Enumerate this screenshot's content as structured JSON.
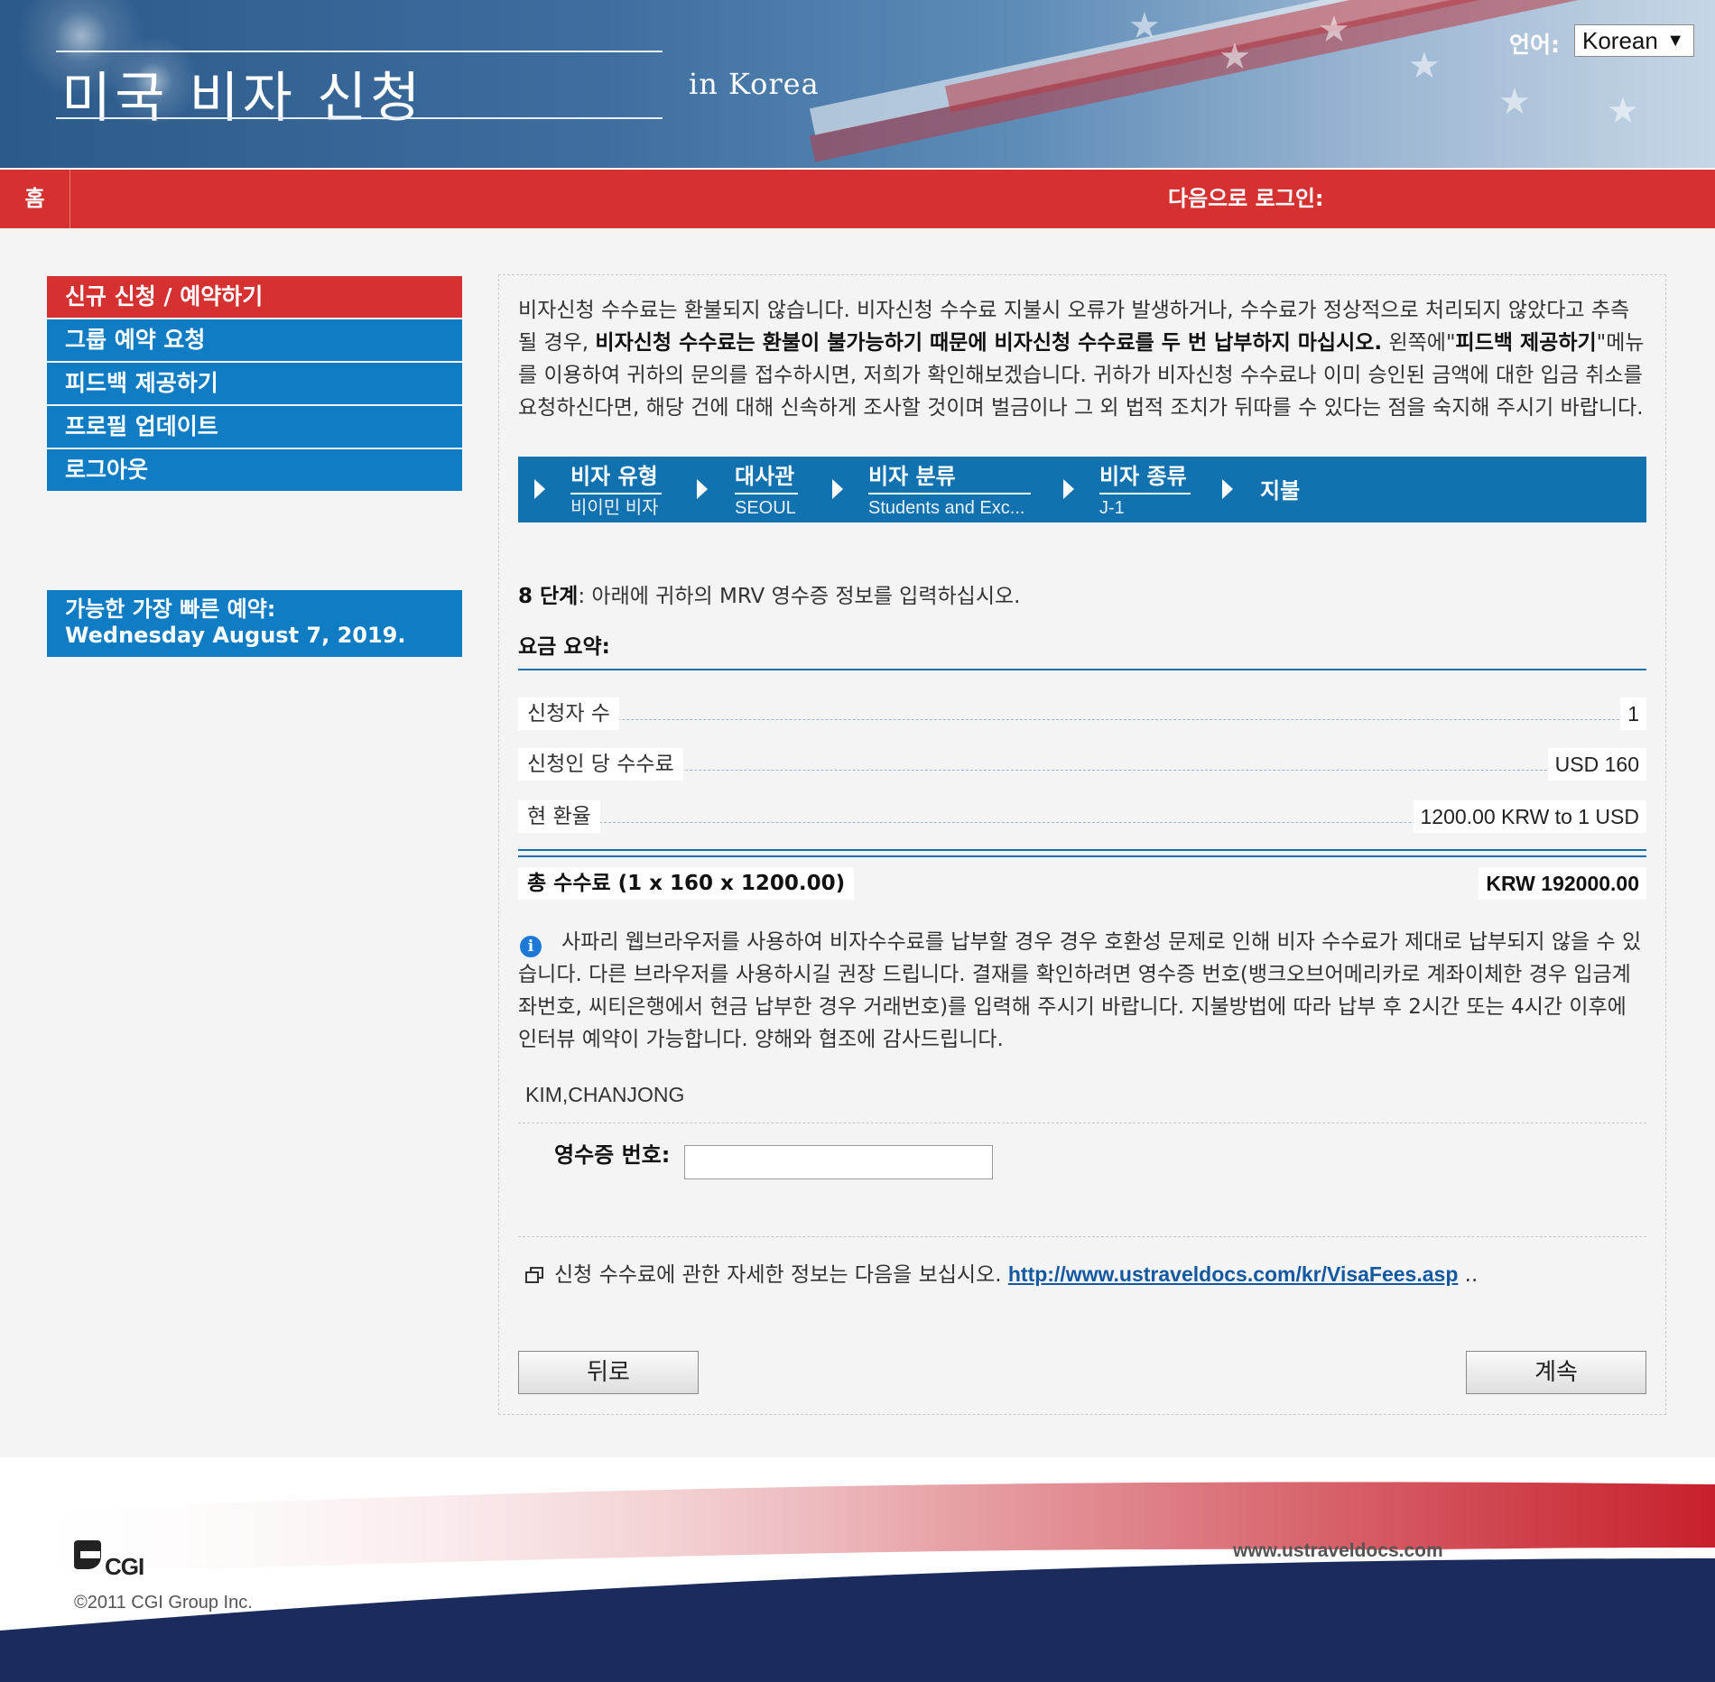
{
  "header": {
    "title": "미국 비자 신청",
    "subtitle": "in  Korea",
    "language_label": "언어:",
    "language_value": "Korean"
  },
  "nav": {
    "home": "홈",
    "logged_in_as": "다음으로 로그인:"
  },
  "sidebar": {
    "items": [
      {
        "label": "신규 신청 / 예약하기",
        "active": true
      },
      {
        "label": "그룹 예약 요청",
        "active": false
      },
      {
        "label": "피드백 제공하기",
        "active": false
      },
      {
        "label": "프로필 업데이트",
        "active": false
      },
      {
        "label": "로그아웃",
        "active": false
      }
    ],
    "earliest_label": "가능한 가장 빠른 예약:",
    "earliest_date": "Wednesday August 7, 2019."
  },
  "intro": {
    "part1": "비자신청 수수료는 환불되지 않습니다. 비자신청 수수료 지불시 오류가 발생하거나, 수수료가 정상적으로 처리되지 않았다고 추측될 경우, ",
    "bold1": "비자신청 수수료는 환불이 불가능하기 때문에 비자신청 수수료를 두 번 납부하지 마십시오.",
    "part2": " 왼쪽에\"",
    "bold2": "피드백 제공하기",
    "part3": "\"메뉴를 이용하여 귀하의 문의를 접수하시면, 저희가 확인해보겠습니다. 귀하가 비자신청 수수료나 이미 승인된 금액에 대한 입금 취소를 요청하신다면, 해당 건에 대해 신속하게 조사할 것이며 벌금이나 그 외 법적 조치가 뒤따를 수 있다는 점을 숙지해 주시기 바랍니다."
  },
  "wizard": {
    "steps": [
      {
        "title": "비자 유형",
        "value": "비이민 비자"
      },
      {
        "title": "대사관",
        "value": "SEOUL"
      },
      {
        "title": "비자 분류",
        "value": "Students and Exc..."
      },
      {
        "title": "비자 종류",
        "value": "J-1"
      }
    ],
    "final": "지불"
  },
  "step": {
    "label": "8 단계",
    "text": ": 아래에 귀하의 MRV 영수증 정보를 입력하십시오."
  },
  "summary": {
    "title": "요금 요약:",
    "rows": [
      {
        "label": "신청자 수",
        "value": "1"
      },
      {
        "label": "신청인 당 수수료",
        "value": "USD 160"
      },
      {
        "label": "현 환율",
        "value": "1200.00 KRW to 1 USD"
      }
    ],
    "total_label": "총 수수료 (1 x 160 x 1200.00)",
    "total_value": "KRW 192000.00"
  },
  "notice": {
    "icon": "info-icon",
    "text": "사파리 웹브라우저를 사용하여 비자수수료를 납부할 경우 경우 호환성 문제로 인해 비자 수수료가 제대로 납부되지 않을 수 있습니다. 다른 브라우저를 사용하시길 권장 드립니다. 결재를 확인하려면 영수증 번호(뱅크오브어메리카로 계좌이체한 경우 입금계좌번호, 씨티은행에서 현금 납부한 경우 거래번호)를 입력해 주시기 바랍니다. 지불방법에 따라 납부 후 2시간 또는 4시간 이후에 인터뷰 예약이 가능합니다. 양해와 협조에 감사드립니다."
  },
  "applicant_name": "KIM,CHANJONG",
  "receipt": {
    "label": "영수증 번호:",
    "value": ""
  },
  "more_info": {
    "text": "신청 수수료에 관한 자세한 정보는 다음을 보십시오.",
    "link": "http://www.ustraveldocs.com/kr/VisaFees.asp",
    "suffix": " .."
  },
  "buttons": {
    "back": "뒤로",
    "continue": "계속"
  },
  "footer": {
    "logo_text": "CGI",
    "copyright": "©2011 CGI Group Inc.",
    "url": "www.ustraveldocs.com"
  },
  "colors": {
    "accent_red": "#d63131",
    "accent_blue": "#0f7cc4",
    "wizard_blue": "#1272b0",
    "link": "#1358a0"
  }
}
